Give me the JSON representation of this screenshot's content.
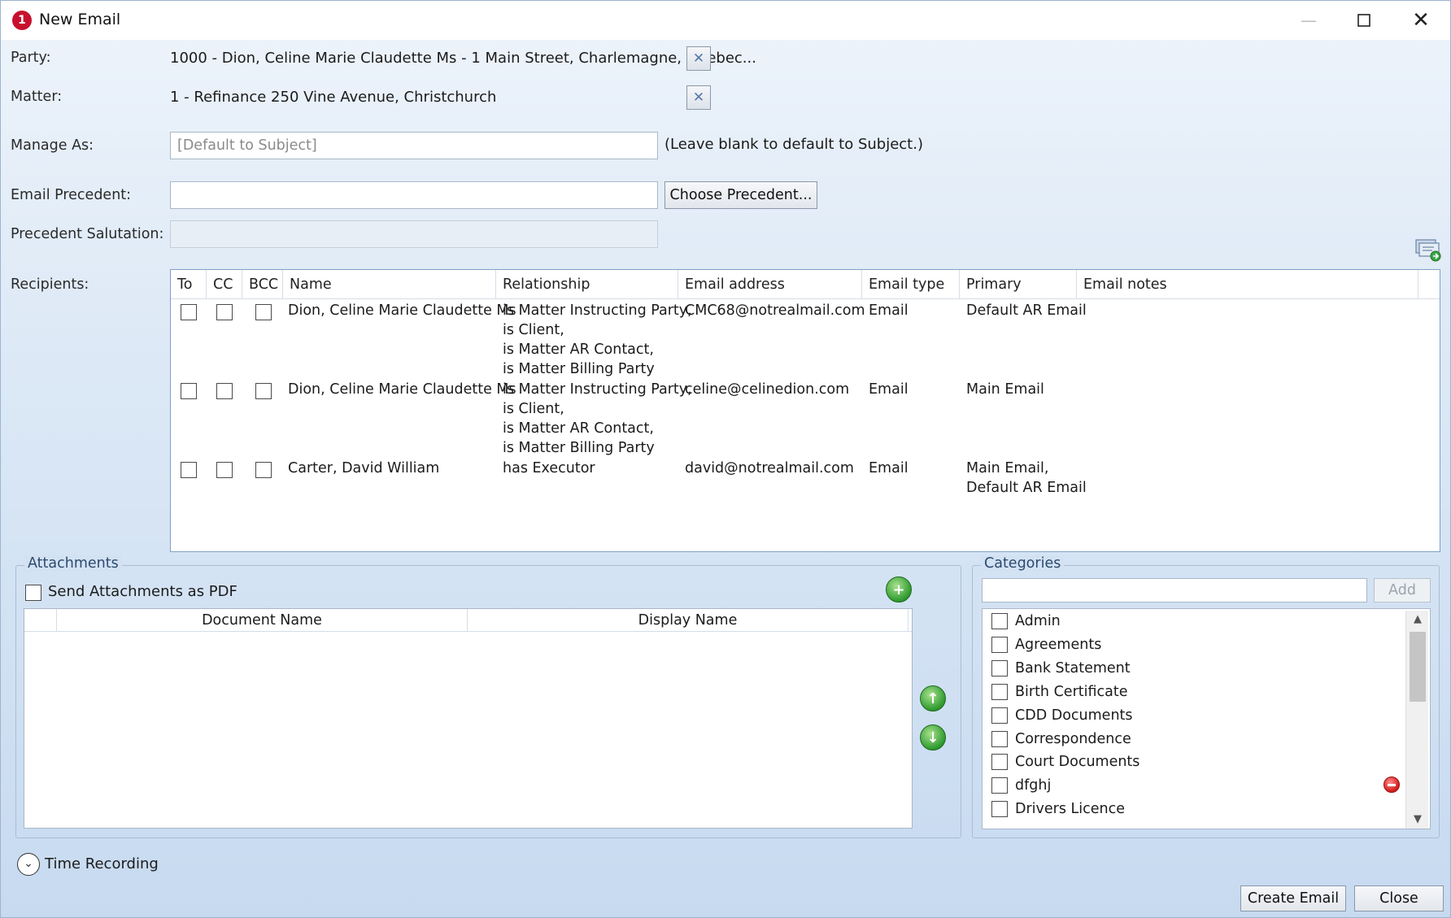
{
  "window": {
    "title": "New Email"
  },
  "labels": {
    "party": "Party:",
    "matter": "Matter:",
    "manage_as": "Manage As:",
    "email_precedent": "Email Precedent:",
    "precedent_salutation": "Precedent Salutation:",
    "recipients": "Recipients:"
  },
  "party_value": "1000 - Dion, Celine Marie Claudette Ms - 1 Main Street, Charlemagne, Quebec...",
  "matter_value": "1 - Refinance 250 Vine Avenue, Christchurch",
  "manage_as": {
    "placeholder": "[Default to Subject]",
    "hint": "(Leave blank to default to Subject.)"
  },
  "email_precedent": {
    "value": "",
    "button": "Choose Precedent..."
  },
  "precedent_salutation": {
    "value": ""
  },
  "recipients": {
    "columns": [
      "To",
      "CC",
      "BCC",
      "Name",
      "Relationship",
      "Email address",
      "Email type",
      "Primary",
      "Email notes"
    ],
    "rows": [
      {
        "name": "Dion, Celine Marie Claudette Ms",
        "relationship": [
          "is Matter Instructing Party,",
          "is Client,",
          "is Matter AR Contact,",
          "is Matter Billing Party"
        ],
        "email": "CMC68@notrealmail.com",
        "type": "Email",
        "primary": [
          "Default AR Email"
        ],
        "notes": ""
      },
      {
        "name": "Dion, Celine Marie Claudette Ms",
        "relationship": [
          "is Matter Instructing Party,",
          "is Client,",
          "is Matter AR Contact,",
          "is Matter Billing Party"
        ],
        "email": "celine@celinedion.com",
        "type": "Email",
        "primary": [
          "Main Email"
        ],
        "notes": ""
      },
      {
        "name": "Carter, David William",
        "relationship": [
          "has Executor"
        ],
        "email": "david@notrealmail.com",
        "type": "Email",
        "primary": [
          "Main Email,",
          "Default AR Email"
        ],
        "notes": ""
      }
    ]
  },
  "attachments": {
    "title": "Attachments",
    "send_as_pdf": "Send Attachments as PDF",
    "columns": [
      "Document Name",
      "Display Name"
    ]
  },
  "categories": {
    "title": "Categories",
    "search_value": "",
    "add_button": "Add",
    "items": [
      "Admin",
      "Agreements",
      "Bank Statement",
      "Birth Certificate",
      "CDD Documents",
      "Correspondence",
      "Court Documents",
      "dfghj",
      "Drivers Licence"
    ]
  },
  "time_recording": "Time Recording",
  "footer": {
    "create": "Create Email",
    "close": "Close"
  },
  "icons": {
    "app": "app-logo-icon",
    "add_attachment": "add-icon",
    "move_up": "arrow-up-icon",
    "move_down": "arrow-down-icon",
    "remove": "remove-icon",
    "address_book": "address-book-icon",
    "expand": "chevron-down-icon"
  }
}
